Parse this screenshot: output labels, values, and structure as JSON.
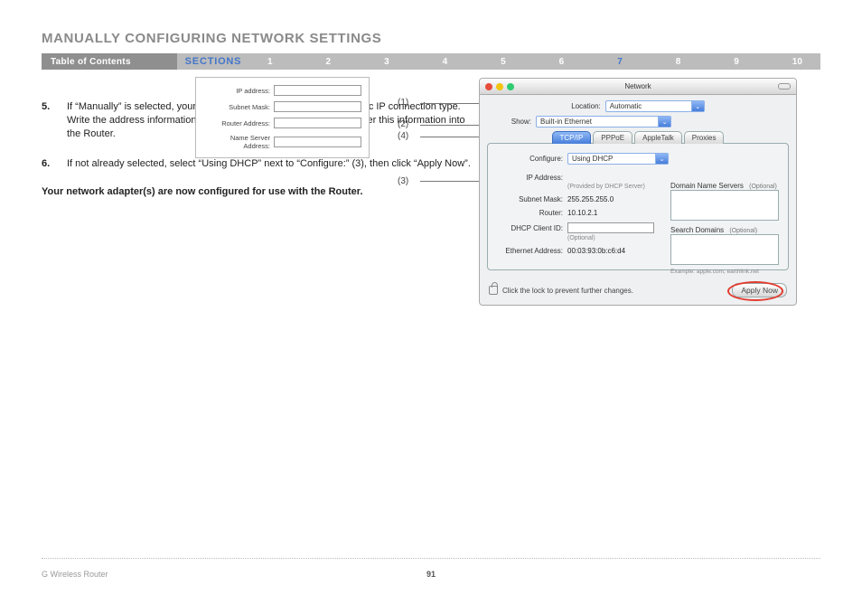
{
  "page": {
    "title": "MANUALLY CONFIGURING NETWORK SETTINGS",
    "number": "91",
    "footer_left": "G Wireless Router"
  },
  "nav": {
    "toc_label": "Table of Contents",
    "sections_label": "SECTIONS",
    "items": [
      "1",
      "2",
      "3",
      "4",
      "5",
      "6",
      "7",
      "8",
      "9",
      "10"
    ],
    "active": "7"
  },
  "steps": [
    {
      "num": "5.",
      "text": "If “Manually” is selected, your Router will need to be set up for a static IP connection type. Write the address information in the table below. You will need to enter this information into the Router."
    },
    {
      "num": "6.",
      "text": "If not already selected, select “Using DHCP” next to “Configure:” (3), then click “Apply Now”."
    }
  ],
  "bold_line": "Your network adapter(s) are now configured for use with the Router.",
  "form_fig": {
    "rows": [
      {
        "label": "IP address:"
      },
      {
        "label": "Subnet Mask:"
      },
      {
        "label": "Router Address:"
      },
      {
        "label": "Name Server Address:"
      }
    ]
  },
  "callouts": {
    "c1": "(1)",
    "c2": "(2)",
    "c3": "(3)",
    "c4": "(4)"
  },
  "mac": {
    "title": "Network",
    "location_label": "Location:",
    "location_value": "Automatic",
    "show_label": "Show:",
    "show_value": "Built-in Ethernet",
    "tabs": [
      "TCP/IP",
      "PPPoE",
      "AppleTalk",
      "Proxies"
    ],
    "active_tab": "TCP/IP",
    "configure_label": "Configure:",
    "configure_value": "Using DHCP",
    "fields": {
      "ip_label": "IP Address:",
      "ip_note": "(Provided by DHCP Server)",
      "subnet_label": "Subnet Mask:",
      "subnet_value": "255.255.255.0",
      "router_label": "Router:",
      "router_value": "10.10.2.1",
      "dhcp_label": "DHCP Client ID:",
      "dhcp_note": "(Optional)",
      "eth_label": "Ethernet Address:",
      "eth_value": "00:03:93:0b:c6:d4"
    },
    "right": {
      "dns_label": "Domain Name Servers",
      "dns_opt": "(Optional)",
      "search_label": "Search Domains",
      "search_opt": "(Optional)",
      "example": "Example: apple.com, earthlink.net"
    },
    "lock_text": "Click the lock to prevent further changes.",
    "apply_label": "Apply Now"
  }
}
